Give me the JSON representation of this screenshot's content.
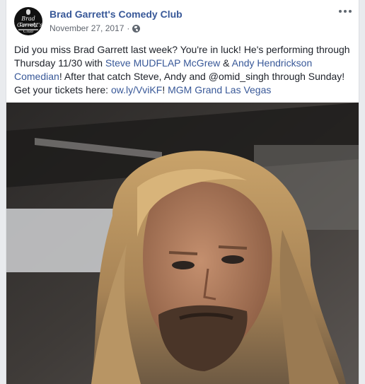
{
  "post": {
    "page_name": "Brad Garrett's Comedy Club",
    "avatar_text_1": "Brad Garrett's",
    "avatar_text_2": "Comedy Club",
    "date": "November 27, 2017",
    "separator": "·",
    "privacy_icon": "globe-icon",
    "more_icon": "more-options-icon",
    "text": {
      "p1": "Did you miss Brad Garrett last week? You're in luck! He's performing through Thursday 11/30 with ",
      "link1": "Steve MUDFLAP McGrew",
      "p2": " & ",
      "link2": "Andy Hendrickson Comedian",
      "p3": "! After that catch Steve, Andy and @omid_singh through Sunday! Get your tickets here: ",
      "link3": "ow.ly/VviKF",
      "p4": "! ",
      "link4": "MGM Grand Las Vegas"
    },
    "photo": "photo of a man with long blonde hair and a beard"
  },
  "colors": {
    "link": "#385898",
    "text": "#1d2129",
    "meta": "#616770",
    "background": "#e9ebee"
  }
}
